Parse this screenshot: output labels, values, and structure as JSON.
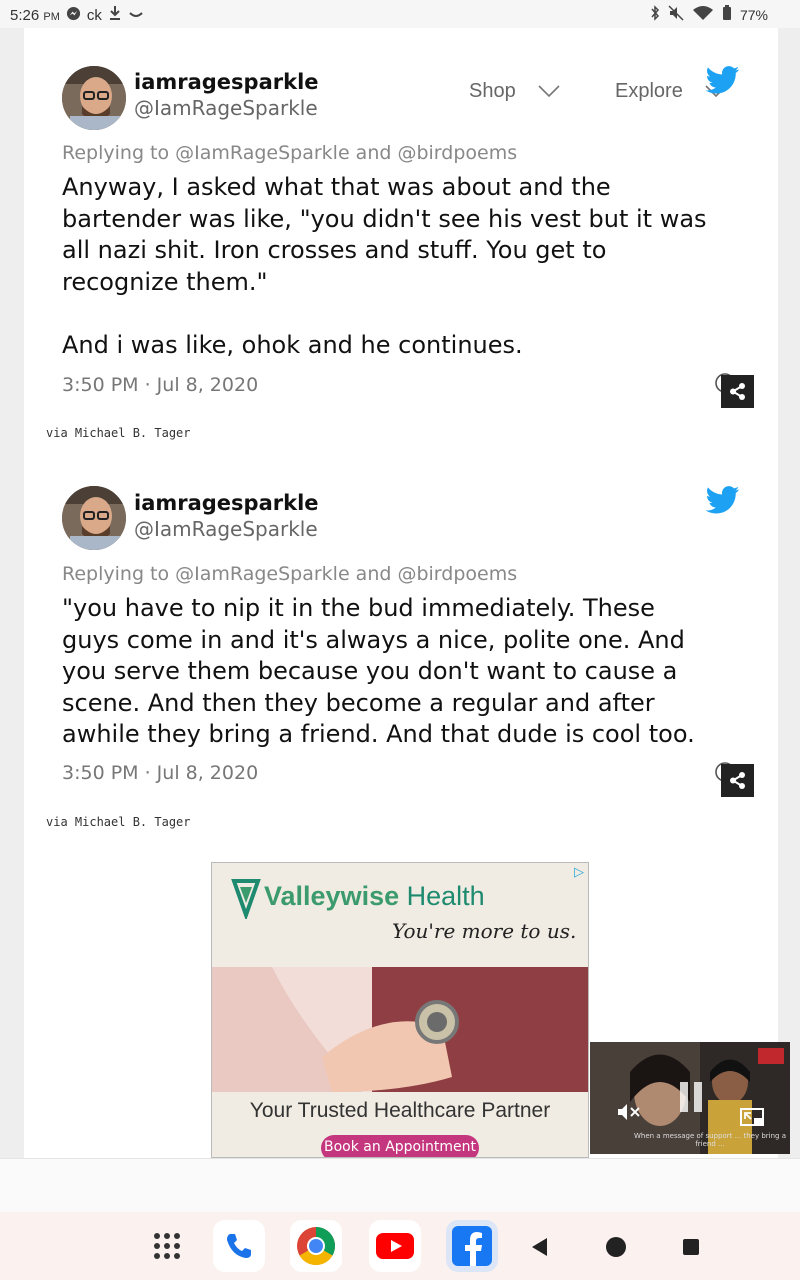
{
  "status_bar": {
    "time": "5:26",
    "ampm": "PM",
    "notif_text": "ck",
    "battery": "77%"
  },
  "nav": {
    "shop": "Shop",
    "explore": "Explore"
  },
  "tweets": [
    {
      "username": "iamragesparkle",
      "handle": "@IamRageSparkle",
      "replying": "Replying to @IamRageSparkle and @birdpoems",
      "body_lines": [
        "Anyway, I asked what that was about and the",
        "bartender was like, \"you didn't see his vest but it was",
        "all nazi shit. Iron crosses and stuff. You get to",
        "recognize them.\"",
        "",
        "And i was like, ohok and he continues."
      ],
      "timestamp": "3:50 PM · Jul 8, 2020",
      "via": "via Michael B. Tager"
    },
    {
      "username": "iamragesparkle",
      "handle": "@IamRageSparkle",
      "replying": "Replying to @IamRageSparkle and @birdpoems",
      "body_lines": [
        "\"you have to nip it in the bud immediately. These",
        "guys come in and it's always a nice, polite one. And",
        "you serve them because you don't want to cause a",
        "scene. And then they become a regular and after",
        "awhile they bring a friend. And that dude is cool too."
      ],
      "timestamp": "3:50 PM · Jul 8, 2020",
      "via": "via Michael B. Tager"
    }
  ],
  "ad": {
    "brand_a": "Valleywise",
    "brand_b": "Health",
    "tagline": "You're more to us.",
    "headline": "Your Trusted Healthcare Partner",
    "cta": "Book an Appointment"
  },
  "video": {
    "caption": "When a message of support ... they bring a friend ..."
  },
  "colors": {
    "twitter_blue": "#1da1f2",
    "ad_green": "#3b9b6e",
    "ad_cta": "#c4377e"
  },
  "dock": {
    "apps": [
      "apps-grid-icon",
      "phone-icon",
      "chrome-icon",
      "youtube-icon",
      "facebook-icon"
    ],
    "nav": [
      "back-icon",
      "home-icon",
      "recents-icon"
    ]
  }
}
